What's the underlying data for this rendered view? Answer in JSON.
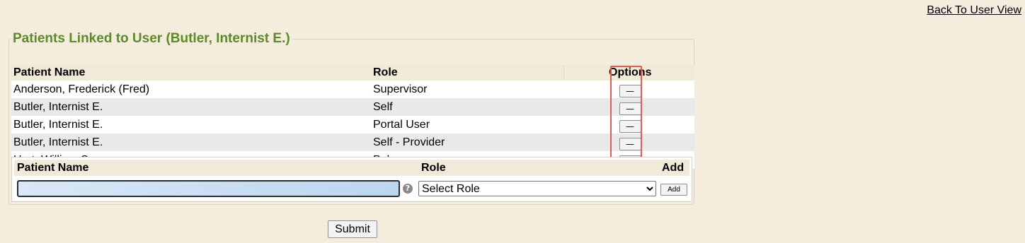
{
  "nav": {
    "back_link": "Back To User View"
  },
  "panel": {
    "title": "Patients Linked to User (Butler, Internist E.)",
    "columns": {
      "patient_name": "Patient Name",
      "role": "Role",
      "options": "Options"
    },
    "rows": [
      {
        "patient": "Anderson, Frederick (Fred)",
        "role": "Supervisor",
        "remove_label": "—"
      },
      {
        "patient": "Butler, Internist E.",
        "role": "Self",
        "remove_label": "—"
      },
      {
        "patient": "Butler, Internist E.",
        "role": "Portal User",
        "remove_label": "—"
      },
      {
        "patient": "Butler, Internist E.",
        "role": "Self - Provider",
        "remove_label": "—"
      },
      {
        "patient": "Hart, William S.",
        "role": "Pulmonary",
        "remove_label": "—"
      }
    ]
  },
  "add_form": {
    "columns": {
      "patient_name": "Patient Name",
      "role": "Role",
      "add": "Add"
    },
    "patient_value": "",
    "help_icon": "question-circle-icon",
    "role_selected": "Select Role",
    "add_label": "Add"
  },
  "submit_label": "Submit",
  "colors": {
    "background": "#f4ecdc",
    "title": "#5c8a2a",
    "highlight": "#e05a58",
    "row_alt": "#e9e9e9"
  }
}
